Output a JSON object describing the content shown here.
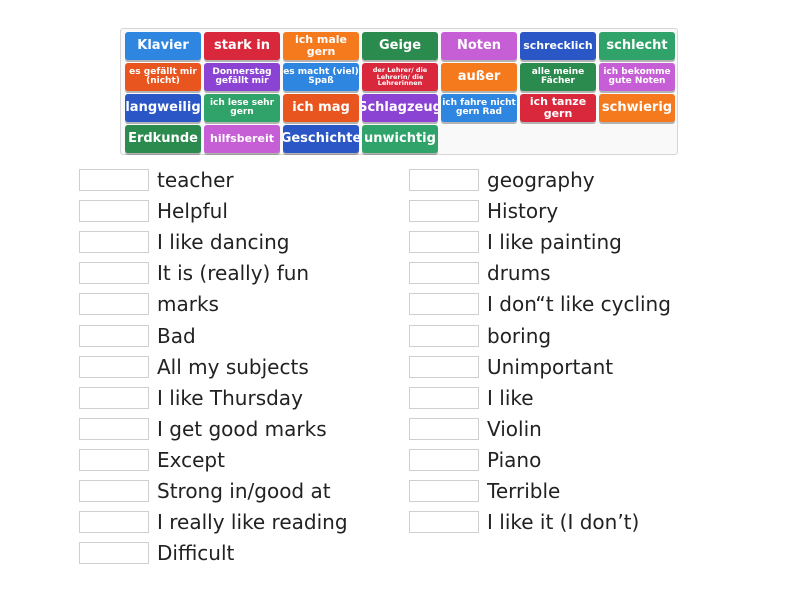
{
  "tiles": [
    {
      "label": "Klavier",
      "color": "#2f86e0"
    },
    {
      "label": "stark in",
      "color": "#d9273b"
    },
    {
      "label": "ich male gern",
      "color": "#f47a1d"
    },
    {
      "label": "Geige",
      "color": "#2b8a4e"
    },
    {
      "label": "Noten",
      "color": "#c65ed6"
    },
    {
      "label": "schrecklich",
      "color": "#2a56c6"
    },
    {
      "label": "schlecht",
      "color": "#2fa36a"
    },
    {
      "label": "es gefällt mir (nicht)",
      "color": "#e9551f"
    },
    {
      "label": "Donnerstag gefällt mir",
      "color": "#8a43d3"
    },
    {
      "label": "es macht (viel) Spaß",
      "color": "#2f86e0"
    },
    {
      "label": "der Lehrer/ die Lehrerin/ die Lehrerinnen",
      "color": "#d9273b"
    },
    {
      "label": "außer",
      "color": "#f47a1d"
    },
    {
      "label": "alle meine Fächer",
      "color": "#2b8a4e"
    },
    {
      "label": "ich bekomme gute Noten",
      "color": "#c65ed6"
    },
    {
      "label": "langweilig",
      "color": "#2a56c6"
    },
    {
      "label": "ich lese sehr gern",
      "color": "#2fa36a"
    },
    {
      "label": "ich mag",
      "color": "#e9551f"
    },
    {
      "label": "Schlagzeug",
      "color": "#8a43d3"
    },
    {
      "label": "ich fahre nicht gern Rad",
      "color": "#2f86e0"
    },
    {
      "label": "ich tanze gern",
      "color": "#d9273b"
    },
    {
      "label": "schwierig",
      "color": "#f47a1d"
    },
    {
      "label": "Erdkunde",
      "color": "#2b8a4e"
    },
    {
      "label": "hilfsbereit",
      "color": "#c65ed6"
    },
    {
      "label": "Geschichte",
      "color": "#2a56c6"
    },
    {
      "label": "unwichtig",
      "color": "#2fa36a"
    }
  ],
  "left_clues": [
    "teacher",
    "Helpful",
    "I like dancing",
    "It is (really) fun",
    "marks",
    "Bad",
    "All my subjects",
    "I like Thursday",
    "I get good marks",
    "Except",
    "Strong in/good at",
    "I really like reading",
    "Difficult"
  ],
  "right_clues": [
    "geography",
    "History",
    "I like painting",
    "drums",
    "I don“t like cycling",
    "boring",
    "Unimportant",
    "I like",
    "Violin",
    "Piano",
    "Terrible",
    "I like it (I don’t)"
  ]
}
